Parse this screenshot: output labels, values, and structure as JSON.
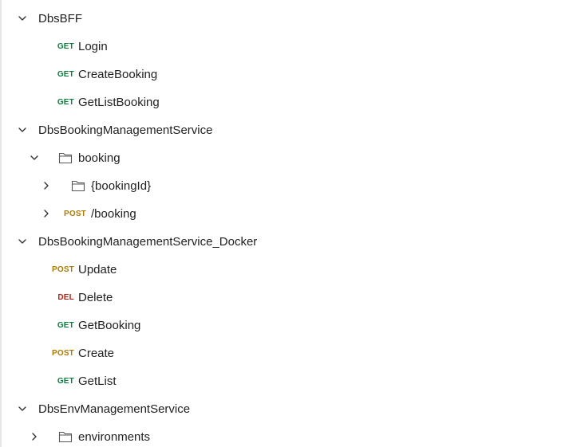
{
  "tree": {
    "collection_1": {
      "name": "DbsBFF",
      "items": [
        {
          "method": "GET",
          "name": "Login"
        },
        {
          "method": "GET",
          "name": "CreateBooking"
        },
        {
          "method": "GET",
          "name": "GetListBooking"
        }
      ]
    },
    "collection_2": {
      "name": "DbsBookingManagementService",
      "folder_booking": {
        "name": "booking",
        "subfolder": {
          "name": "{bookingId}"
        },
        "request": {
          "method": "POST",
          "name": "/booking"
        }
      }
    },
    "collection_3": {
      "name": "DbsBookingManagementService_Docker",
      "items": [
        {
          "method": "POST",
          "name": "Update"
        },
        {
          "method": "DEL",
          "name": "Delete"
        },
        {
          "method": "GET",
          "name": "GetBooking"
        },
        {
          "method": "POST",
          "name": "Create"
        },
        {
          "method": "GET",
          "name": "GetList"
        }
      ]
    },
    "collection_4": {
      "name": "DbsEnvManagementService",
      "folder_environments": {
        "name": "environments"
      }
    }
  },
  "icons": {
    "expanded": "chevron-down-icon",
    "collapsed": "chevron-right-icon",
    "folder": "folder-icon"
  },
  "colors": {
    "get": "#0b7d3e",
    "post": "#ad7a03",
    "delete": "#b42318",
    "text": "#212121"
  }
}
